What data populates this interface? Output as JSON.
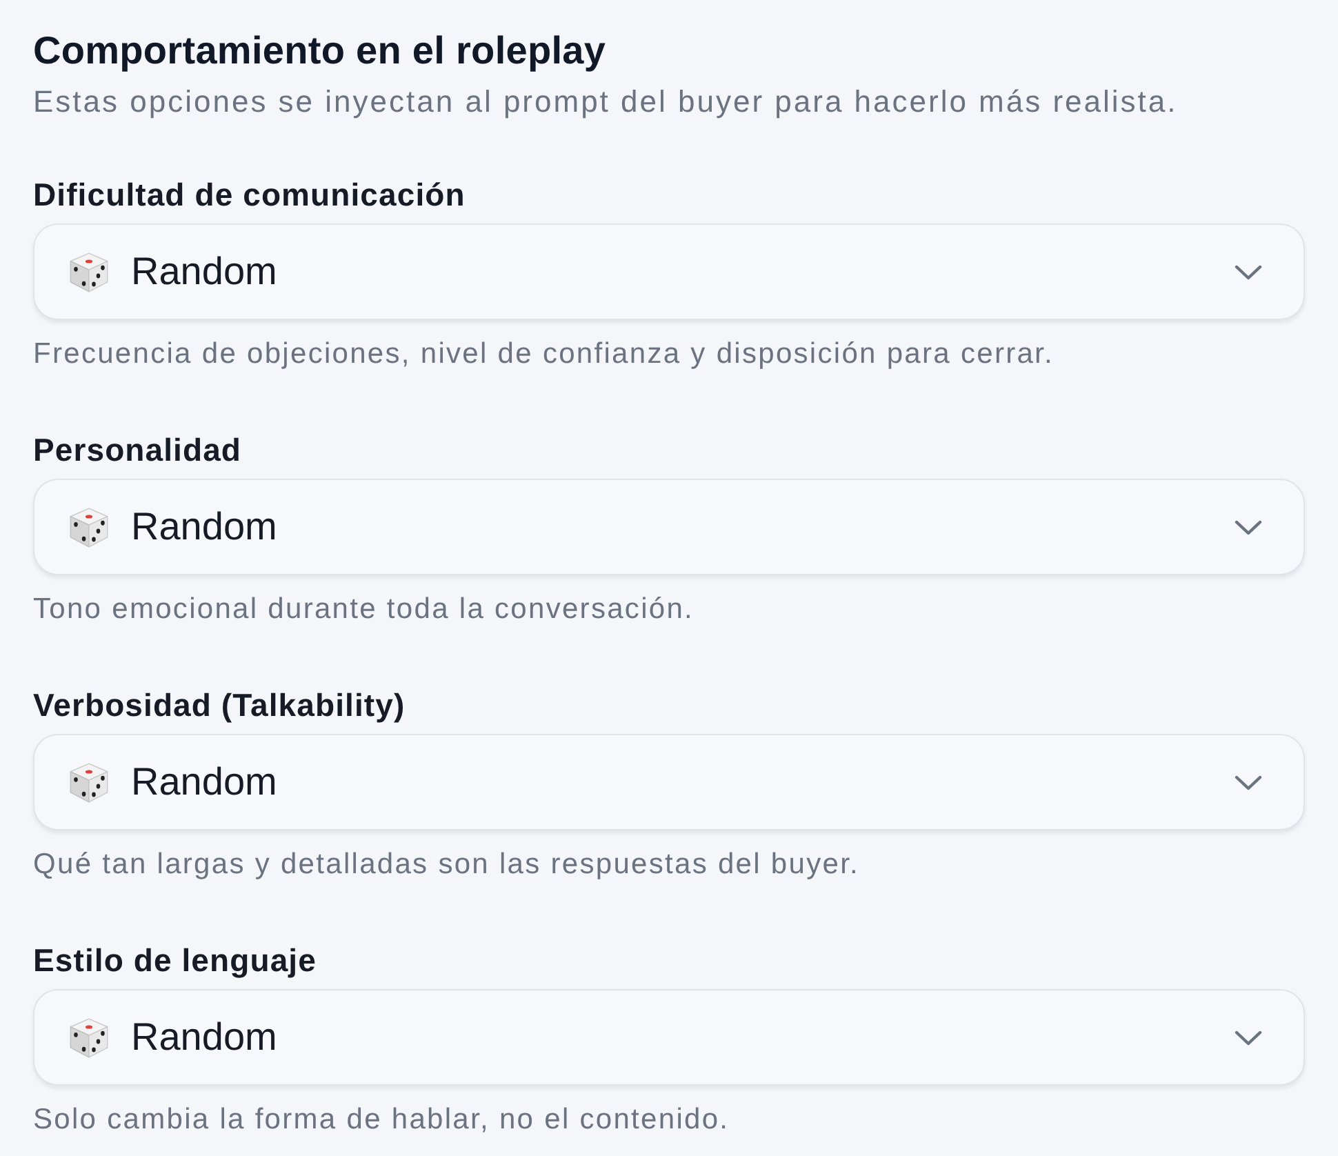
{
  "section": {
    "title": "Comportamiento en el roleplay",
    "description": "Estas opciones se inyectan al prompt del buyer para hacerlo más realista."
  },
  "fields": [
    {
      "label": "Dificultad de comunicación",
      "value": "Random",
      "help": "Frecuencia de objeciones, nivel de confianza y disposición para cerrar."
    },
    {
      "label": "Personalidad",
      "value": "Random",
      "help": "Tono emocional durante toda la conversación."
    },
    {
      "label": "Verbosidad (Talkability)",
      "value": "Random",
      "help": "Qué tan largas y detalladas son las respuestas del buyer."
    },
    {
      "label": "Estilo de lenguaje",
      "value": "Random",
      "help": "Solo cambia la forma de hablar, no el contenido."
    }
  ]
}
